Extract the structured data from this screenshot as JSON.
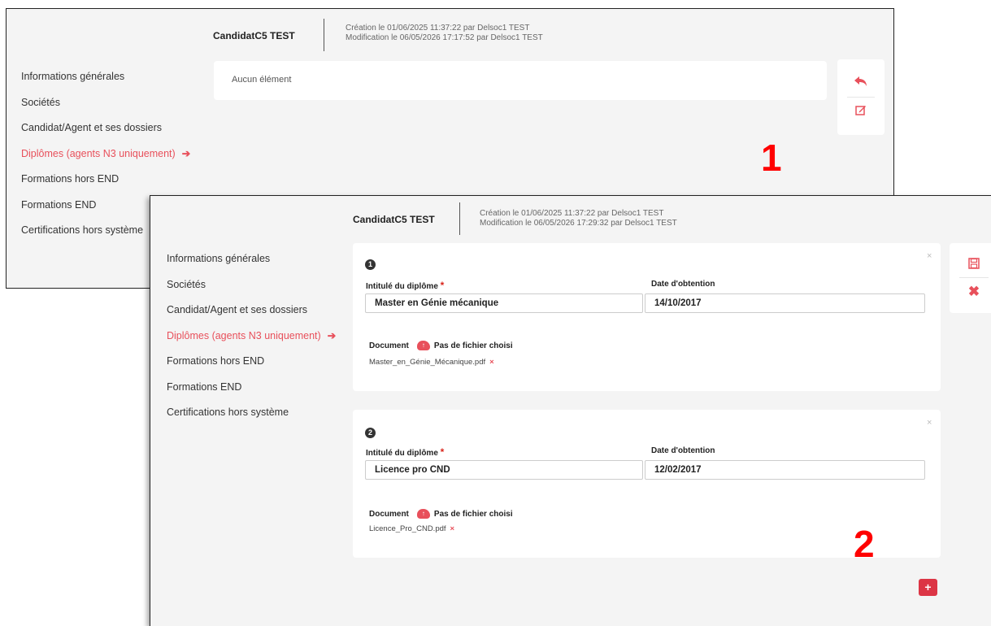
{
  "window1": {
    "candidate_name": "CandidatC5 TEST",
    "created": "Création le 01/06/2025 11:37:22 par Delsoc1 TEST",
    "modified": "Modification le 06/05/2026 17:17:52 par Delsoc1 TEST",
    "nav": [
      {
        "label": "Informations générales"
      },
      {
        "label": "Sociétés"
      },
      {
        "label": "Candidat/Agent et ses dossiers"
      },
      {
        "label": "Diplômes (agents N3 uniquement)",
        "active": true
      },
      {
        "label": "Formations hors END"
      },
      {
        "label": "Formations END"
      },
      {
        "label": "Certifications hors système"
      }
    ],
    "empty_text": "Aucun élément",
    "actions": {
      "back_icon": "undo-arrow-icon",
      "edit_icon": "edit-icon"
    },
    "step_label": "1"
  },
  "window2": {
    "candidate_name": "CandidatC5 TEST",
    "created": "Création le 01/06/2025 11:37:22 par Delsoc1 TEST",
    "modified": "Modification le 06/05/2026 17:29:32 par Delsoc1 TEST",
    "nav": [
      {
        "label": "Informations générales"
      },
      {
        "label": "Sociétés"
      },
      {
        "label": "Candidat/Agent et ses dossiers"
      },
      {
        "label": "Diplômes (agents N3 uniquement)",
        "active": true
      },
      {
        "label": "Formations hors END"
      },
      {
        "label": "Formations END"
      },
      {
        "label": "Certifications hors système"
      }
    ],
    "diplomas": [
      {
        "number": "1",
        "title_label": "Intitulé du diplôme",
        "title_value": "Master en Génie mécanique",
        "date_label": "Date d'obtention",
        "date_value": "14/10/2017",
        "doc_label": "Document",
        "no_file": "Pas de fichier choisi",
        "file_name": "Master_en_Génie_Mécanique.pdf"
      },
      {
        "number": "2",
        "title_label": "Intitulé du diplôme",
        "title_value": "Licence pro CND",
        "date_label": "Date d'obtention",
        "date_value": "12/02/2017",
        "doc_label": "Document",
        "no_file": "Pas de fichier choisi",
        "file_name": "Licence_Pro_CND.pdf"
      }
    ],
    "actions": {
      "save_icon": "save-icon",
      "cancel_icon": "close-icon"
    },
    "add_label": "+",
    "step_label": "2"
  },
  "colors": {
    "accent": "#e8505b",
    "annotation": "#ff0000",
    "add_button": "#dc3545"
  }
}
